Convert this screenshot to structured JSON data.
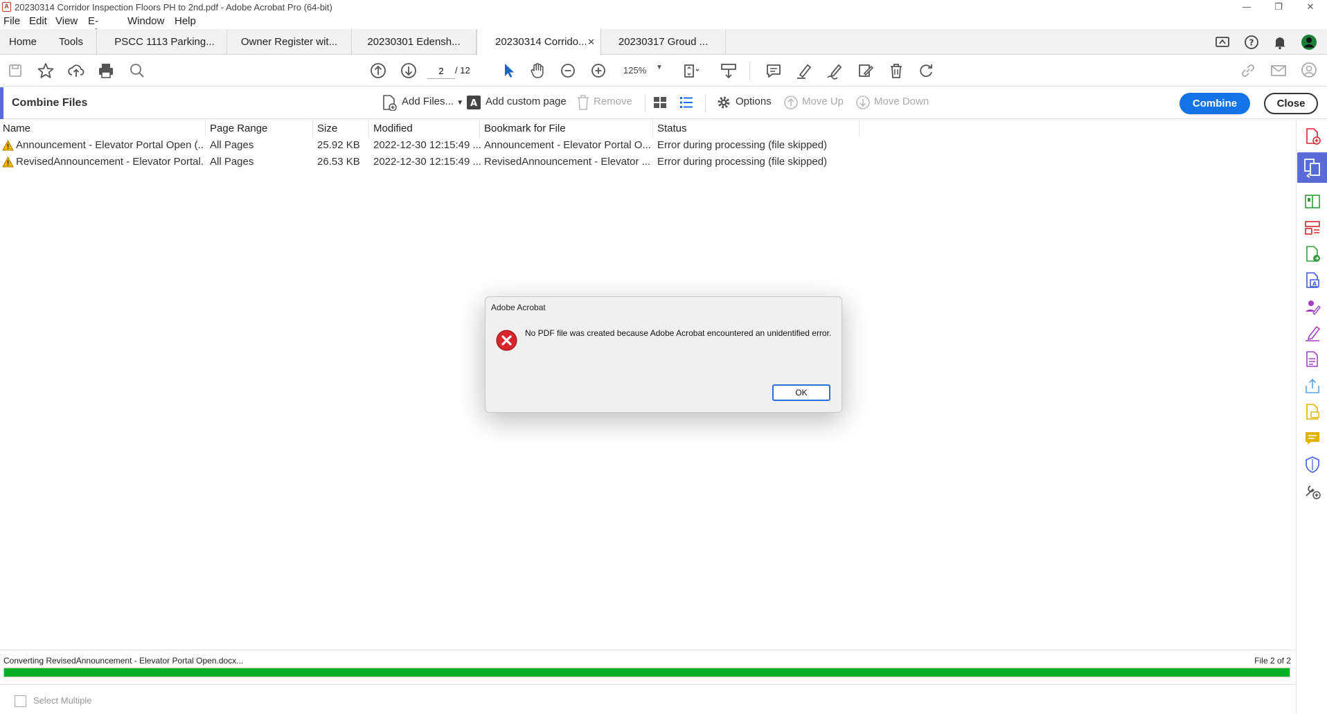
{
  "window": {
    "title": "20230314  Corridor Inspection Floors PH to 2nd.pdf - Adobe Acrobat Pro (64-bit)",
    "minimize": "—",
    "restore": "❐",
    "close": "✕"
  },
  "menu": [
    "File",
    "Edit",
    "View",
    "E-Sign",
    "Window",
    "Help"
  ],
  "tabs": {
    "home": "Home",
    "tools": "Tools",
    "docs": [
      {
        "label": "PSCC 1113 Parking..."
      },
      {
        "label": "Owner Register wit..."
      },
      {
        "label": "20230301  Edensh..."
      },
      {
        "label": "20230314  Corrido...",
        "active": true
      },
      {
        "label": "20230317  Groud ..."
      }
    ],
    "close_glyph": "✕"
  },
  "toolbar": {
    "page_current": "2",
    "page_total": "/ 12",
    "zoom": "125%"
  },
  "combine": {
    "title": "Combine Files",
    "add_files": "Add Files...",
    "add_custom_page": "Add custom page",
    "remove": "Remove",
    "options": "Options",
    "move_up": "Move Up",
    "move_down": "Move Down",
    "combine_btn": "Combine",
    "close_btn": "Close"
  },
  "table": {
    "headers": [
      "Name",
      "Page Range",
      "Size",
      "Modified",
      "Bookmark for File",
      "Status"
    ],
    "rows": [
      {
        "name": "Announcement - Elevator Portal Open (...",
        "page_range": "All Pages",
        "size": "25.92 KB",
        "modified": "2022-12-30 12:15:49 ...",
        "bookmark": "Announcement - Elevator Portal O...",
        "status": "Error during processing (file skipped)"
      },
      {
        "name": "RevisedAnnouncement - Elevator Portal...",
        "page_range": "All Pages",
        "size": "26.53 KB",
        "modified": "2022-12-30 12:15:49 ...",
        "bookmark": "RevisedAnnouncement - Elevator ...",
        "status": "Error during processing (file skipped)"
      }
    ]
  },
  "dialog": {
    "title": "Adobe Acrobat",
    "message": "No PDF file was created because Adobe Acrobat encountered an unidentified error.",
    "ok": "OK"
  },
  "status": {
    "text": "Converting RevisedAnnouncement - Elevator Portal Open.docx...",
    "count": "File 2 of 2",
    "progress": 1.0
  },
  "footer": {
    "select_multiple": "Select Multiple"
  },
  "colors": {
    "accent": "#1473e6",
    "panel_accent": "#5a6ad6",
    "progress": "#06b025",
    "error": "#d9232d",
    "warning": "#f4b400"
  }
}
